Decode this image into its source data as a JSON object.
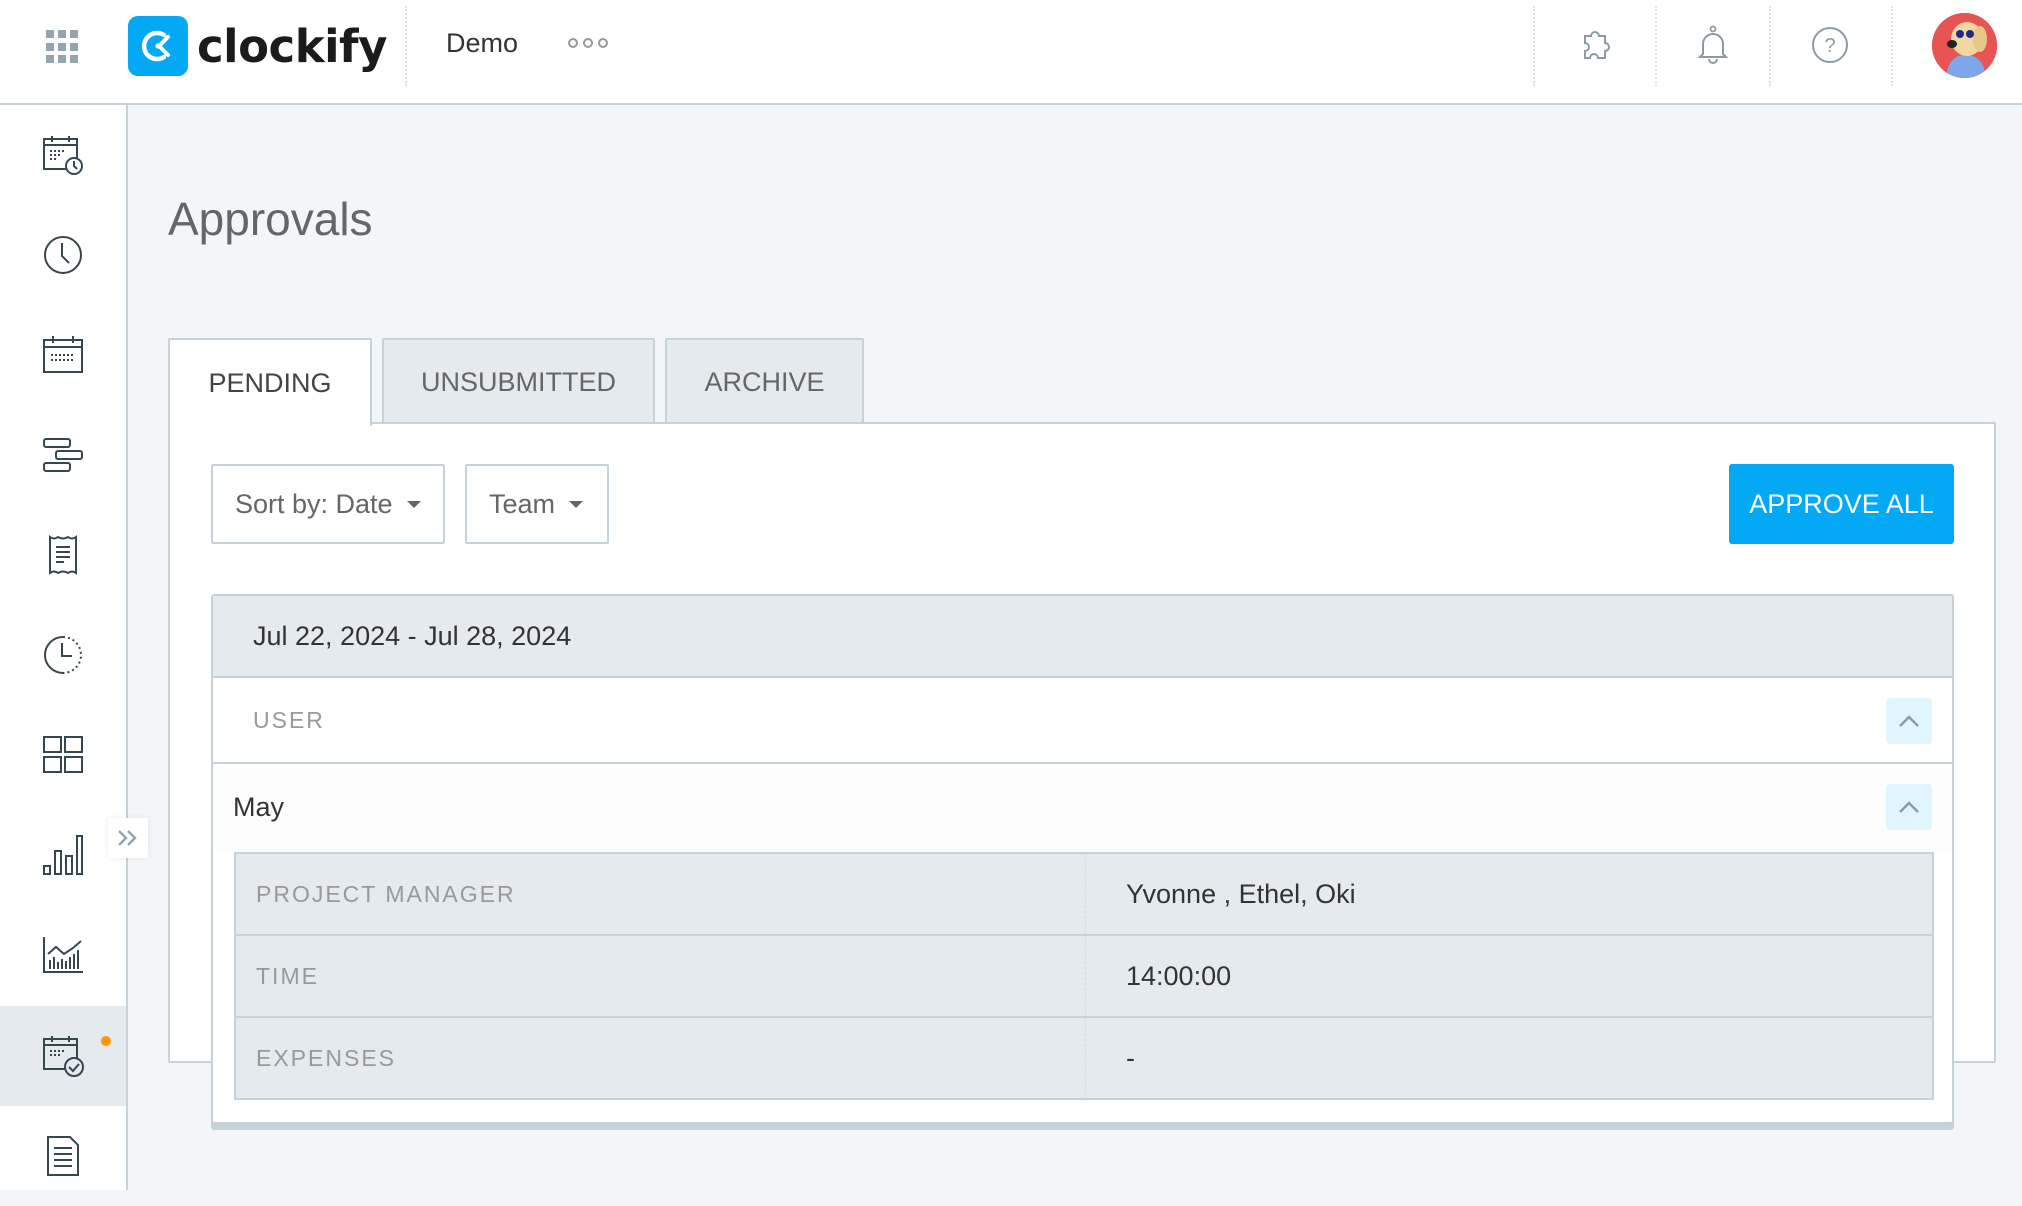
{
  "header": {
    "app_name": "clockify",
    "workspace": "Demo",
    "icons": [
      "apps-grid-icon",
      "integrations-puzzle-icon",
      "notifications-bell-icon",
      "help-question-icon",
      "user-avatar"
    ]
  },
  "sidebar": {
    "items": [
      {
        "name": "timesheet",
        "icon": "calendar-clock-icon"
      },
      {
        "name": "time-tracker",
        "icon": "clock-icon"
      },
      {
        "name": "calendar",
        "icon": "calendar-icon"
      },
      {
        "name": "schedule",
        "icon": "gantt-bars-icon"
      },
      {
        "name": "expenses",
        "icon": "receipt-icon"
      },
      {
        "name": "time-off",
        "icon": "dotted-clock-icon"
      },
      {
        "name": "dashboard",
        "icon": "grid-icon"
      },
      {
        "name": "reports",
        "icon": "bar-chart-icon"
      },
      {
        "name": "activity",
        "icon": "line-bar-chart-icon"
      },
      {
        "name": "approvals",
        "icon": "calendar-check-icon",
        "active": true,
        "has_notification": true
      },
      {
        "name": "invoices",
        "icon": "document-icon"
      }
    ],
    "notification_color": "#ff9800"
  },
  "page": {
    "title": "Approvals",
    "tabs": [
      {
        "label": "PENDING",
        "active": true
      },
      {
        "label": "UNSUBMITTED",
        "active": false
      },
      {
        "label": "ARCHIVE",
        "active": false
      }
    ],
    "sort_dropdown": "Sort by: Date",
    "team_dropdown": "Team",
    "approve_all": "APPROVE ALL",
    "accent_color": "#03a9f4"
  },
  "week_group": {
    "date_range": "Jul 22, 2024 - Jul 28, 2024",
    "user_header": "USER",
    "user": {
      "name": "May",
      "details": [
        {
          "label": "PROJECT MANAGER",
          "value": "Yvonne , Ethel, Oki"
        },
        {
          "label": "TIME",
          "value": "14:00:00"
        },
        {
          "label": "EXPENSES",
          "value": "-"
        }
      ]
    }
  }
}
